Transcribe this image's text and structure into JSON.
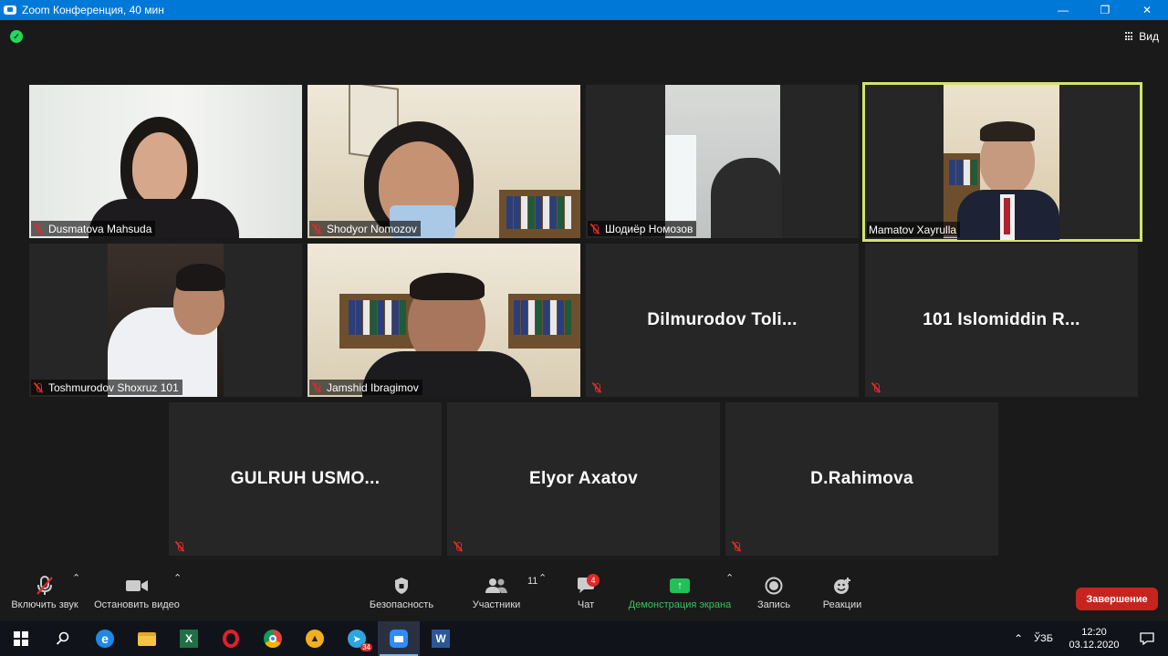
{
  "window": {
    "title": "Zoom Конференция, 40 мин",
    "controls": [
      "minimize-icon",
      "restore-icon",
      "close-icon"
    ]
  },
  "topbar": {
    "view_label": "Вид"
  },
  "participants": [
    {
      "name": "Dusmatova Mahsuda",
      "video": true,
      "muted": true
    },
    {
      "name": "Shodyor Nomozov",
      "video": true,
      "muted": true
    },
    {
      "name": "Шодиёр Номозов",
      "video": true,
      "muted": true
    },
    {
      "name": "Mamatov Xayrulla",
      "video": true,
      "muted": false,
      "active_speaker": true
    },
    {
      "name": "Toshmurodov Shoxruz 101",
      "video": true,
      "muted": true
    },
    {
      "name": "Jamshid Ibragimov",
      "video": true,
      "muted": true
    },
    {
      "name": "Dilmurodov  Toli...",
      "video": false,
      "muted": true
    },
    {
      "name": "101  Islomiddin  R...",
      "video": false,
      "muted": true
    },
    {
      "name": "GULRUH  USMO...",
      "video": false,
      "muted": true
    },
    {
      "name": "Elyor Axatov",
      "video": false,
      "muted": true
    },
    {
      "name": "D.Rahimova",
      "video": false,
      "muted": true
    }
  ],
  "toolbar": {
    "unmute_label": "Включить звук",
    "stop_video_label": "Остановить видео",
    "security_label": "Безопасность",
    "participants_label": "Участники",
    "participants_count": "11",
    "chat_label": "Чат",
    "chat_badge": "4",
    "share_label": "Демонстрация экрана",
    "record_label": "Запись",
    "reactions_label": "Реакции",
    "end_label": "Завершение"
  },
  "taskbar": {
    "apps": [
      "windows-start-icon",
      "search-icon",
      "edge-icon",
      "file-explorer-icon",
      "excel-icon",
      "opera-icon",
      "chrome-icon",
      "app-triangle-icon",
      "telegram-icon",
      "zoom-icon",
      "word-icon"
    ],
    "telegram_badge": "34",
    "language": "ЎЗБ",
    "time": "12:20",
    "date": "03.12.2020"
  },
  "colors": {
    "titlebar": "#0078d7",
    "active_speaker_border": "#d4e36a",
    "end_button": "#c7241f",
    "share_green": "#23c058",
    "muted_red": "#e02828"
  }
}
